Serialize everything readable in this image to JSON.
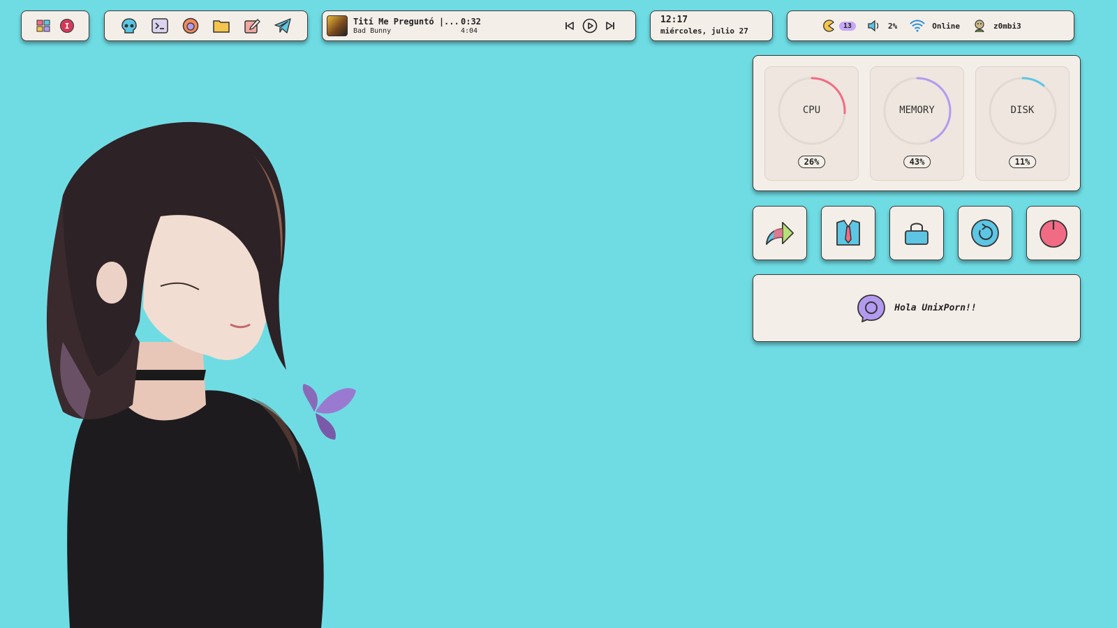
{
  "launcher": {
    "start_icon": "windows-grid-icon",
    "user_initial": "I"
  },
  "apps": [
    {
      "name": "skull-icon"
    },
    {
      "name": "terminal-icon"
    },
    {
      "name": "firefox-icon"
    },
    {
      "name": "folder-icon"
    },
    {
      "name": "editor-icon"
    },
    {
      "name": "telegram-icon"
    }
  ],
  "music": {
    "title": "Tití Me Preguntó |...",
    "artist": "Bad Bunny",
    "elapsed": "0:32",
    "duration": "4:04"
  },
  "clock": {
    "time": "12:17",
    "date": "miércoles, julio 27"
  },
  "status": {
    "updates_count": "13",
    "volume": "2%",
    "network": "Online",
    "username": "z0mbi3"
  },
  "stats": [
    {
      "label": "CPU",
      "value": "26%",
      "fraction": 0.26,
      "color": "#f26b85"
    },
    {
      "label": "MEMORY",
      "value": "43%",
      "fraction": 0.43,
      "color": "#b39af0"
    },
    {
      "label": "DISK",
      "value": "11%",
      "fraction": 0.11,
      "color": "#5cc6e4"
    }
  ],
  "actions": [
    {
      "name": "share-icon"
    },
    {
      "name": "shirt-tie-icon"
    },
    {
      "name": "lock-icon"
    },
    {
      "name": "refresh-icon"
    },
    {
      "name": "power-icon"
    }
  ],
  "greeting": {
    "text": "Hola UnixPorn!!"
  },
  "colors": {
    "background": "#6fdce4",
    "panel": "#f4eee8",
    "accent_pink": "#f26b85",
    "accent_purple": "#b39af0",
    "accent_blue": "#5cc6e4"
  }
}
